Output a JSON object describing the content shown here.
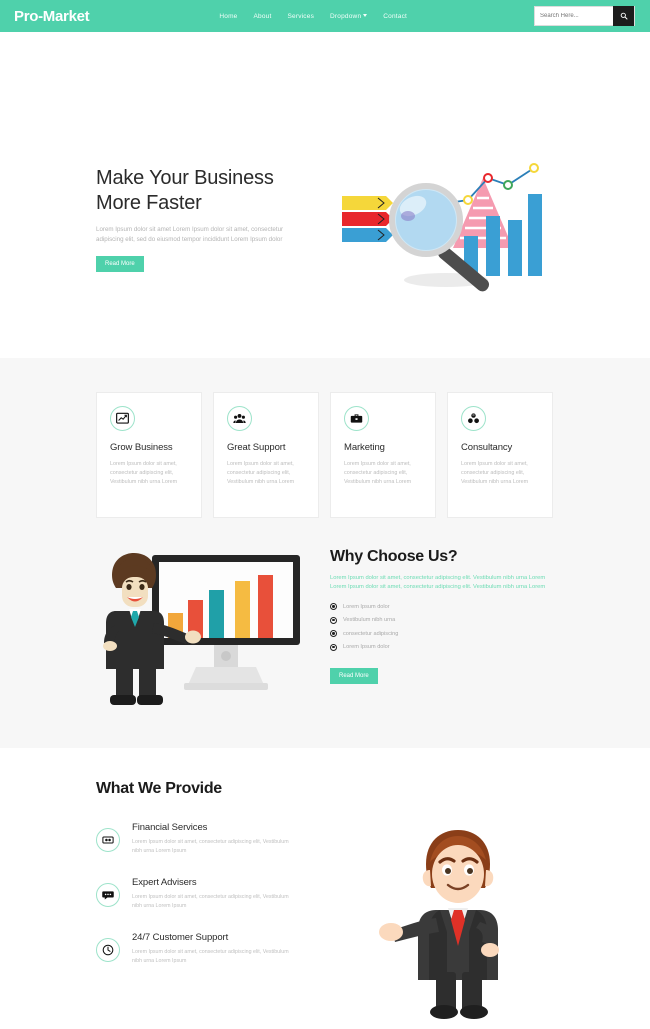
{
  "header": {
    "logo": "Pro-Market",
    "nav": [
      {
        "label": "Home",
        "name": "nav-home"
      },
      {
        "label": "About",
        "name": "nav-about"
      },
      {
        "label": "Services",
        "name": "nav-services"
      },
      {
        "label": "Dropdown",
        "name": "nav-dropdown",
        "caret": true
      },
      {
        "label": "Contact",
        "name": "nav-contact"
      }
    ],
    "search": {
      "placeholder": "Search Here...",
      "value": "",
      "icon": "search-icon"
    },
    "bg_color": "#4fd1ab"
  },
  "hero": {
    "title_line1": "Make Your Business",
    "title_line2": "More Faster",
    "paragraph": "Lorem Ipsum dolor sit amet Lorem Ipsum dolor sit amet, consectetur adipiscing elit, sed do eiusmod tempor incididunt Lorem Ipsum dolor",
    "button": "Read More",
    "illustration": "magnifier-bar-chart-illustration"
  },
  "services": {
    "cards": [
      {
        "title": "Grow Business",
        "icon": "chart-line-icon",
        "text": "Lorem Ipsum dolor sit amet, consectetur adipiscing elit, Vestibulum nibh urna Lorem"
      },
      {
        "title": "Great Support",
        "icon": "users-group-icon",
        "text": "Lorem Ipsum dolor sit amet, consectetur adipiscing elit, Vestibulum nibh urna Lorem"
      },
      {
        "title": "Marketing",
        "icon": "briefcase-icon",
        "text": "Lorem Ipsum dolor sit amet, consectetur adipiscing elit, Vestibulum nibh urna Lorem"
      },
      {
        "title": "Consultancy",
        "icon": "cubes-icon",
        "text": "Lorem Ipsum dolor sit amet, consectetur adipiscing elit, Vestibulum nibh urna Lorem"
      }
    ]
  },
  "why_choose": {
    "heading": "Why Choose Us?",
    "paragraph": "Lorem Ipsum dolor sit amet, consectetur adipiscing elit. Vestibulum nibh urna Lorem Lorem Ipsum dolor sit amet, consectetur adipiscing elit. Vestibulum nibh urna Lorem",
    "list": [
      "Lorem Ipsum dolor",
      "Vestibulum nibh urna",
      "consectetur adipiscing",
      "Lorem Ipsum dolor"
    ],
    "button": "Read More",
    "illustration": "businessman-presenting-chart-monitor"
  },
  "provide": {
    "heading": "What We Provide",
    "items": [
      {
        "title": "Financial Services",
        "icon": "money-bill-icon",
        "text": "Lorem Ipsum dolor sit amet, consectetur adipiscing elit, Vestibulum nibh urna Lorem Ipsum"
      },
      {
        "title": "Expert Advisers",
        "icon": "comment-icon",
        "text": "Lorem Ipsum dolor sit amet, consectetur adipiscing elit, Vestibulum nibh urna Lorem Ipsum"
      },
      {
        "title": "24/7 Customer Support",
        "icon": "clock-icon",
        "text": "Lorem Ipsum dolor sit amet, consectetur adipiscing elit, Vestibulum nibh urna Lorem Ipsum"
      }
    ],
    "illustration": "cartoon-businessman-pointing"
  },
  "colors": {
    "accent": "#4fd1ab",
    "accent_light": "#6ddcb4",
    "section_bg": "#f7f7f7",
    "dark": "#1c1c1c"
  }
}
